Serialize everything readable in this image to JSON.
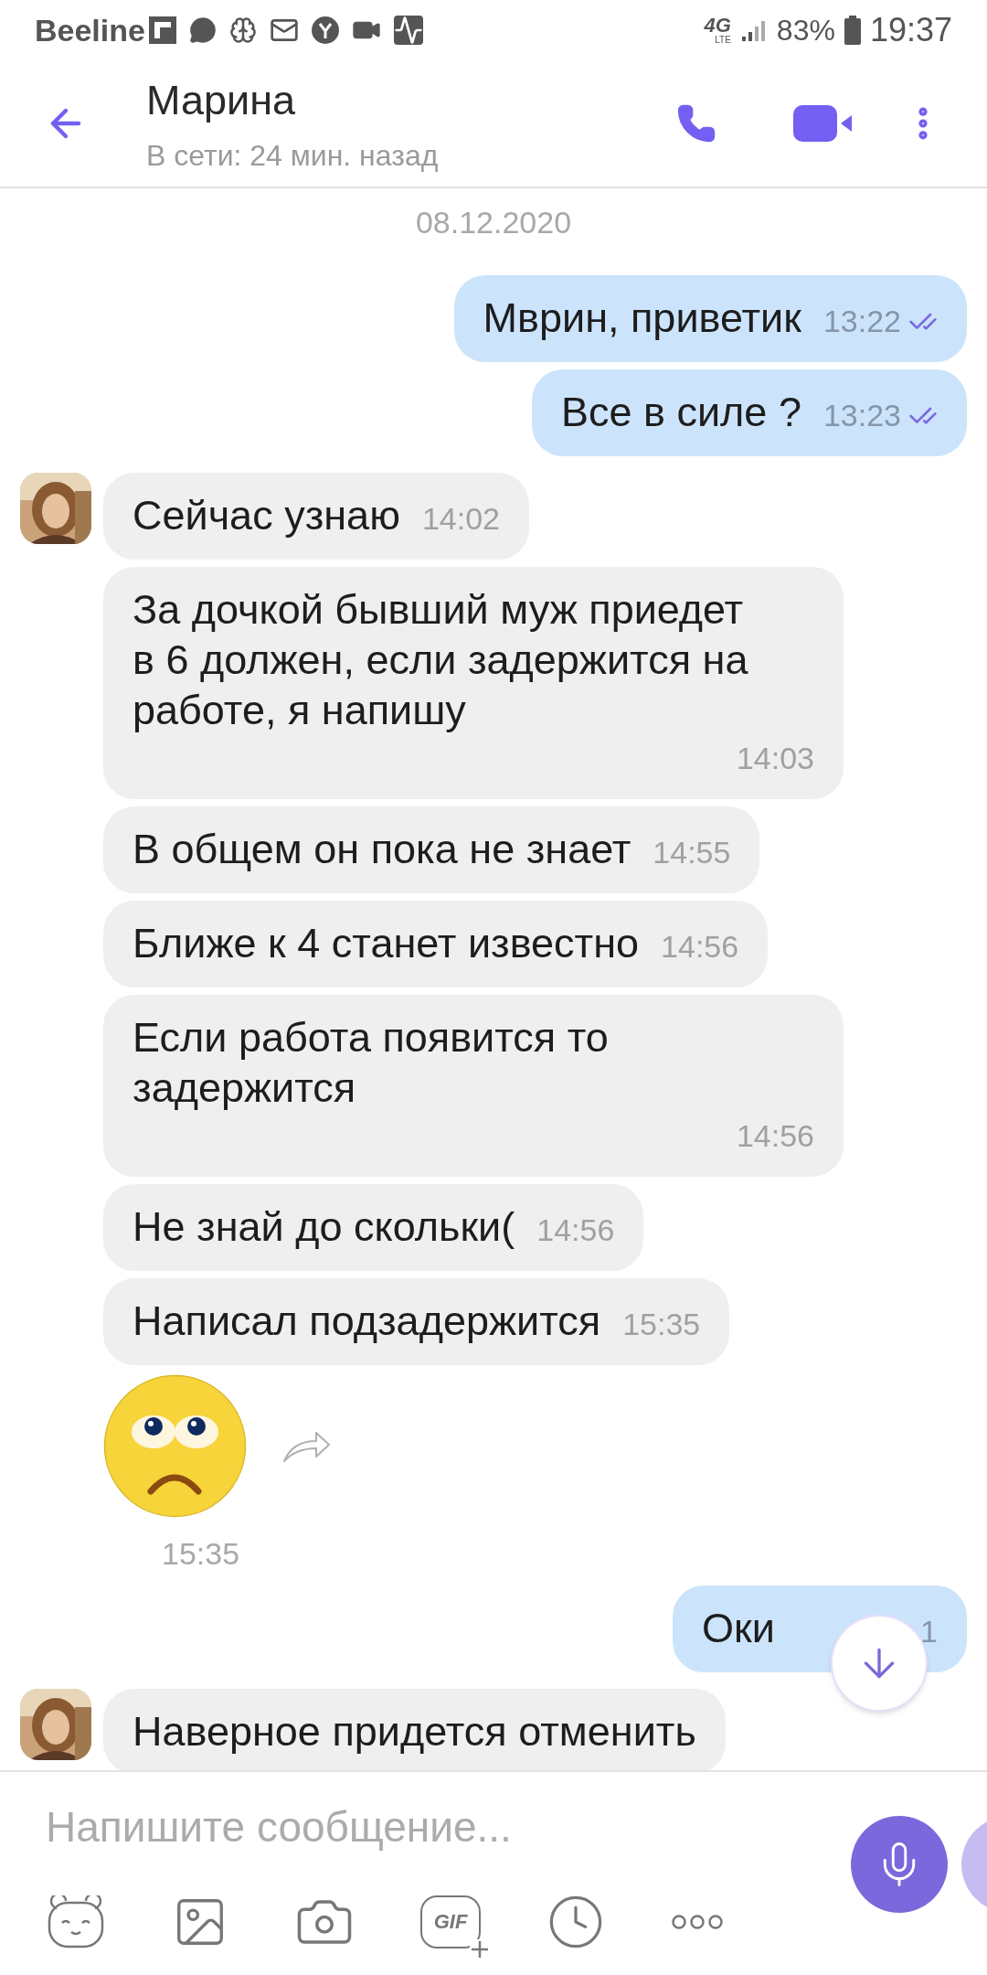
{
  "status_bar": {
    "carrier": "Beeline",
    "network": "4G",
    "network_sub": "LTE",
    "battery": "83%",
    "time": "19:37"
  },
  "header": {
    "title": "Марина",
    "subtitle": "В сети: 24 мин. назад"
  },
  "date": "08.12.2020",
  "messages": [
    {
      "kind": "outgoing",
      "text": "Мврин, приветик",
      "time": "13:22",
      "read": true
    },
    {
      "kind": "outgoing",
      "text": "Все в силе ?",
      "time": "13:23",
      "read": true
    },
    {
      "kind": "incoming",
      "text": "Сейчас узнаю",
      "time": "14:02"
    },
    {
      "kind": "incoming",
      "text": "За дочкой бывший муж приедет в 6 должен, если задержится на работе, я напишу",
      "time": "14:03"
    },
    {
      "kind": "incoming",
      "text": "В общем он пока не знает",
      "time": "14:55"
    },
    {
      "kind": "incoming",
      "text": "Ближе к 4 станет известно",
      "time": "14:56"
    },
    {
      "kind": "incoming",
      "text": "Если работа появится то задержится",
      "time": "14:56"
    },
    {
      "kind": "incoming",
      "text": "Не знай до скольки(",
      "time": "14:56"
    },
    {
      "kind": "incoming",
      "text": "Написал подзадержится",
      "time": "15:35"
    },
    {
      "kind": "sticker",
      "time": "15:35"
    },
    {
      "kind": "outgoing",
      "text": "Оки",
      "time": "1"
    },
    {
      "kind": "incoming",
      "text": "Наверное придется отменить"
    }
  ],
  "composer": {
    "placeholder": "Напишите сообщение...",
    "gif_label": "GIF"
  }
}
